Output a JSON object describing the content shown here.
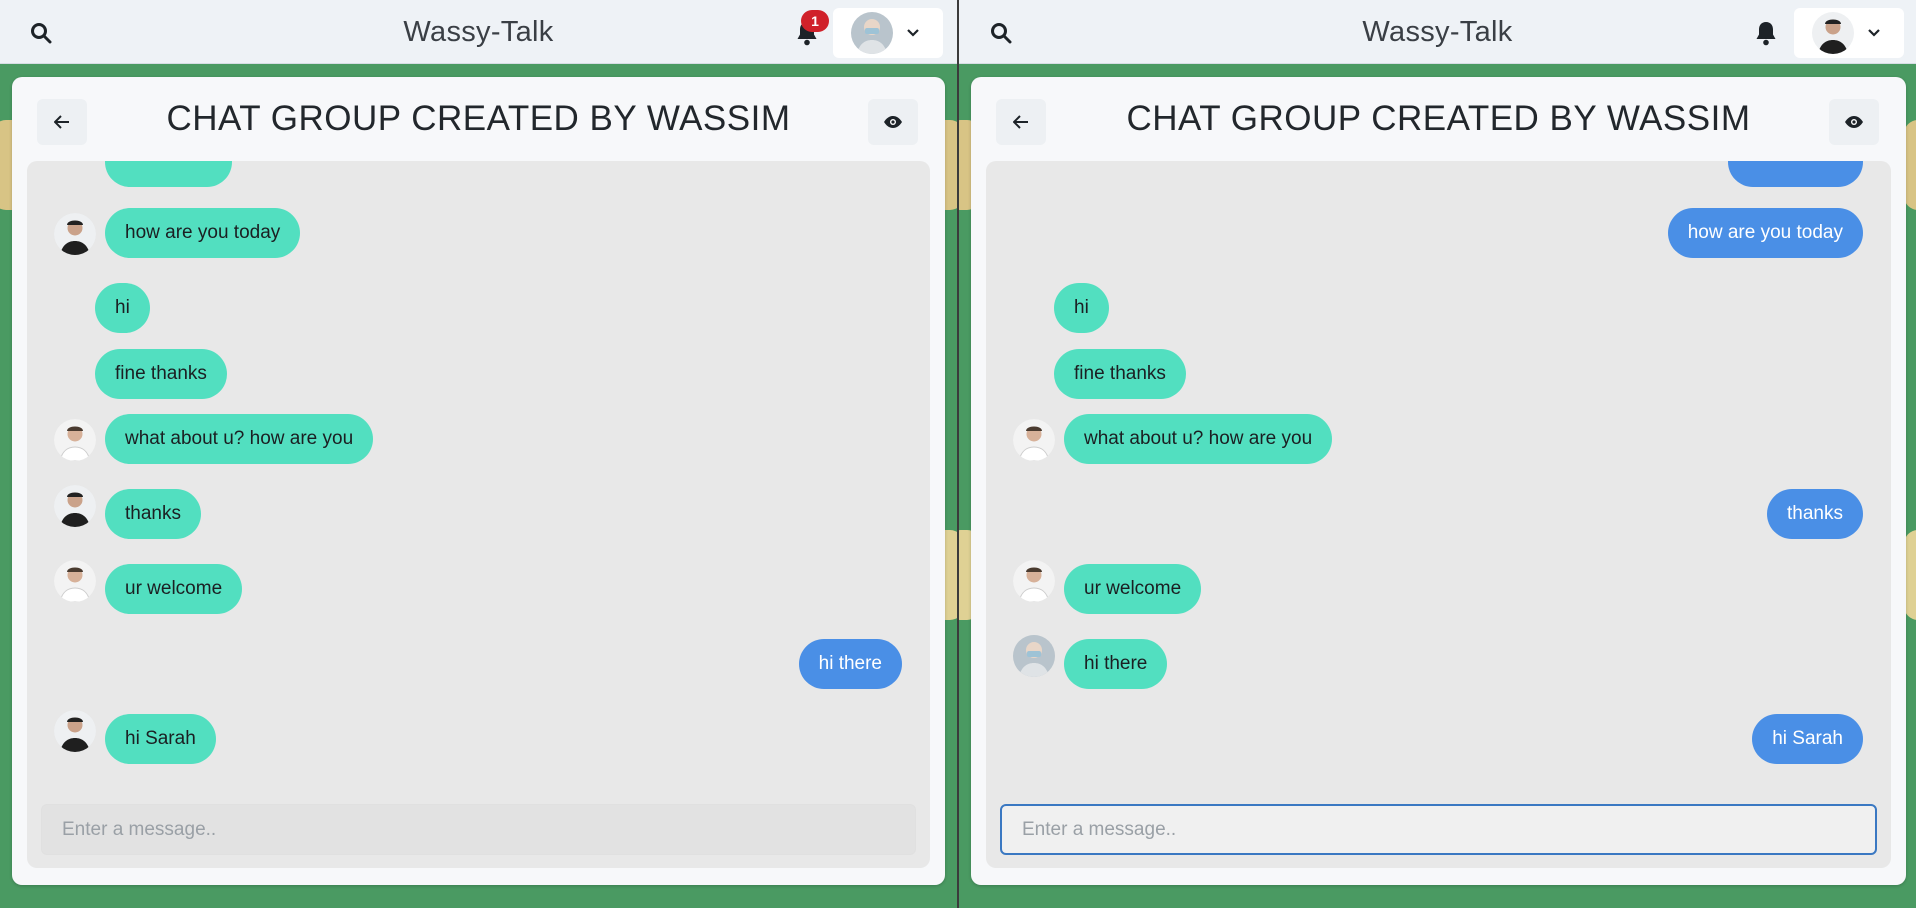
{
  "app_title": "Wassy-Talk",
  "group_title": "CHAT GROUP CREATED BY WASSIM",
  "input_placeholder": "Enter a message..",
  "colors": {
    "teal_bubble": "#52dfc0",
    "blue_bubble": "#4a8fe6",
    "badge": "#d0212a",
    "background": "#4a9a62"
  },
  "icons": {
    "search": "search-icon",
    "bell": "bell-icon",
    "chevron": "chevron-down-icon",
    "back": "arrow-left-icon",
    "eye": "eye-icon"
  },
  "left": {
    "notification_count": "1",
    "messages": [
      {
        "text": "how are you today",
        "style": "teal",
        "avatar": "man-dark"
      },
      {
        "text": "hi",
        "style": "teal",
        "avatar": ""
      },
      {
        "text": "fine thanks",
        "style": "teal",
        "avatar": ""
      },
      {
        "text": "what about u? how are you",
        "style": "teal",
        "avatar": "man-light"
      },
      {
        "text": "thanks",
        "style": "teal",
        "avatar": "man-dark"
      },
      {
        "text": "ur welcome",
        "style": "teal",
        "avatar": "man-light"
      },
      {
        "text": "hi there",
        "style": "blue",
        "avatar": ""
      },
      {
        "text": "hi Sarah",
        "style": "teal",
        "avatar": "man-dark"
      }
    ]
  },
  "right": {
    "messages": [
      {
        "text": "how are you today",
        "style": "blue",
        "avatar": ""
      },
      {
        "text": "hi",
        "style": "teal",
        "avatar": ""
      },
      {
        "text": "fine thanks",
        "style": "teal",
        "avatar": ""
      },
      {
        "text": "what about u? how are you",
        "style": "teal",
        "avatar": "man-light"
      },
      {
        "text": "thanks",
        "style": "blue",
        "avatar": ""
      },
      {
        "text": "ur welcome",
        "style": "teal",
        "avatar": "man-light"
      },
      {
        "text": "hi there",
        "style": "teal",
        "avatar": "woman-mask"
      },
      {
        "text": "hi Sarah",
        "style": "blue",
        "avatar": ""
      }
    ]
  }
}
